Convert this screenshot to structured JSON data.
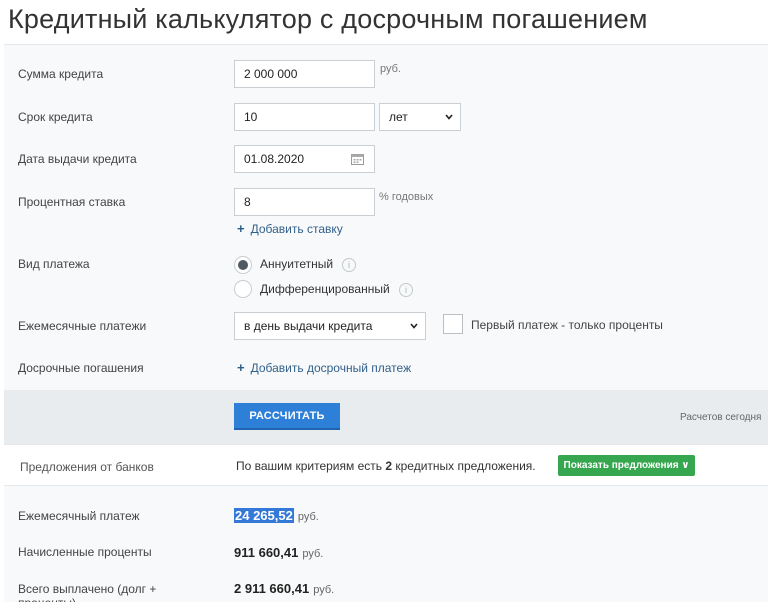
{
  "page_title": "Кредитный калькулятор с досрочным погашением",
  "form": {
    "amount": {
      "label": "Сумма кредита",
      "value": "2 000 000",
      "unit": "руб."
    },
    "term": {
      "label": "Срок кредита",
      "value": "10",
      "unit_selected": "лет"
    },
    "issue_date": {
      "label": "Дата выдачи кредита",
      "value": "01.08.2020"
    },
    "rate": {
      "label": "Процентная ставка",
      "value": "8",
      "unit": "% годовых",
      "add_rate_link": "Добавить ставку"
    },
    "payment_type": {
      "label": "Вид платежа",
      "options": [
        {
          "label": "Аннуитетный",
          "selected": true
        },
        {
          "label": "Дифференцированный",
          "selected": false
        }
      ]
    },
    "monthly_payments": {
      "label": "Ежемесячные платежи",
      "selected": "в день выдачи кредита",
      "checkbox_label": "Первый платеж - только проценты"
    },
    "early_repayments": {
      "label": "Досрочные погашения",
      "add_link": "Добавить досрочный платеж"
    }
  },
  "calc": {
    "button_label": "РАССЧИТАТЬ",
    "count_text": "Расчетов сегодня"
  },
  "offers": {
    "label": "Предложения от банков",
    "text_prefix": "По вашим критериям есть ",
    "count": "2",
    "text_suffix": " кредитных предложения.",
    "button_label": "Показать предложения ∨"
  },
  "results": [
    {
      "label": "Ежемесячный платеж",
      "value": "24 265,52",
      "unit": "руб."
    },
    {
      "label": "Начисленные проценты",
      "value": "911 660,41",
      "unit": "руб."
    },
    {
      "label": "Всего выплачено (долг + проценты)",
      "value": "2 911 660,41",
      "unit": "руб."
    }
  ],
  "colors": {
    "primary_button": "#2d7fd8",
    "offers_button": "#36a64f",
    "link": "#33608a",
    "highlight": "#3478d8"
  }
}
